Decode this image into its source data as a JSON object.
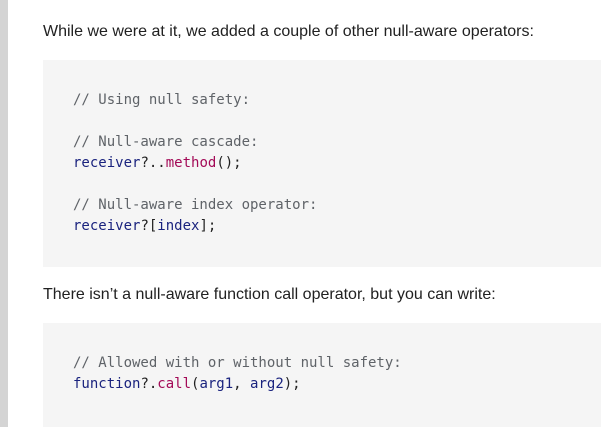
{
  "intro_paragraph": "While we were at it, we added a couple of other null-aware operators:",
  "code_block_1": {
    "comment_header": "// Using null safety:",
    "comment_cascade": "// Null-aware cascade:",
    "cascade_receiver": "receiver",
    "cascade_operator": "?..",
    "cascade_method": "method",
    "cascade_end": "();",
    "comment_index": "// Null-aware index operator:",
    "index_receiver": "receiver",
    "index_open": "?[",
    "index_name": "index",
    "index_close": "];"
  },
  "middle_paragraph": "There isn’t a null-aware function call operator, but you can write:",
  "code_block_2": {
    "comment": "// Allowed with or without null safety:",
    "function_name": "function",
    "call_operator": "?.",
    "call_method": "call",
    "args_open": "(",
    "arg1": "arg1",
    "comma": ", ",
    "arg2": "arg2",
    "args_close": ");"
  },
  "colors": {
    "code_background": "#f5f5f5",
    "comment": "#5f6368",
    "identifier": "#1a237e",
    "method": "#a30a57",
    "left_rule": "#d4d4d4"
  }
}
